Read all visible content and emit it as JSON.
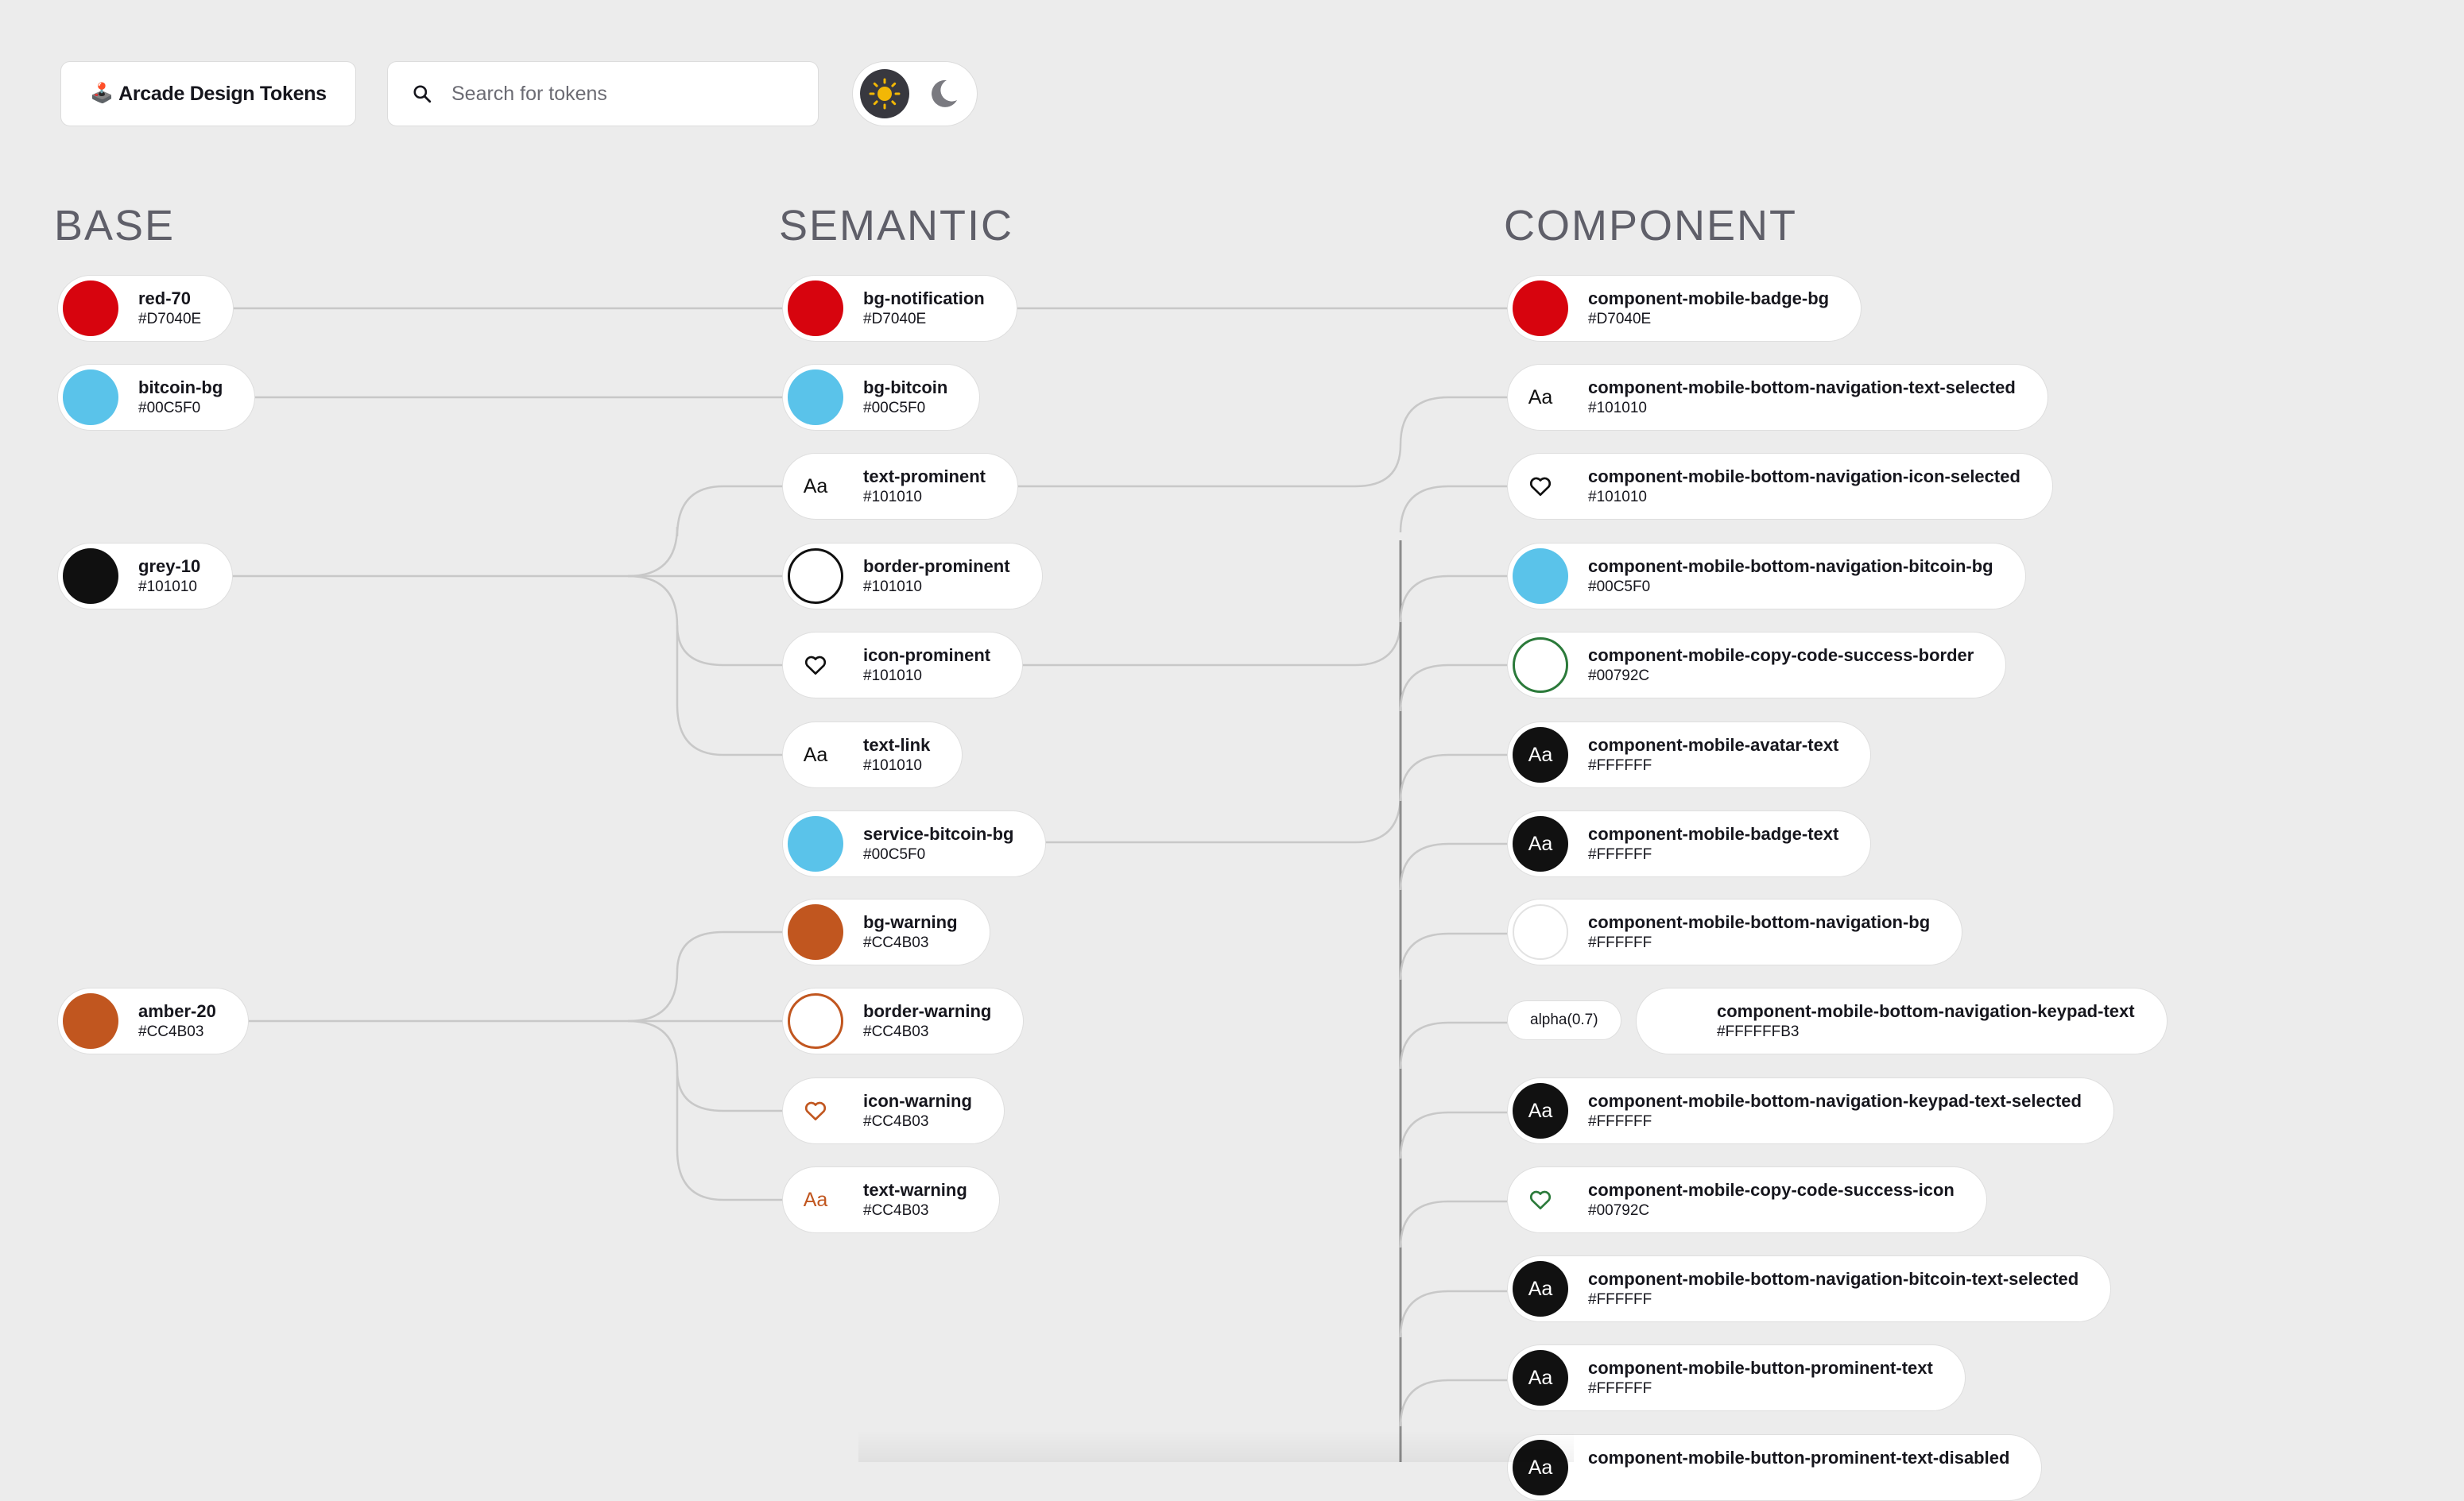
{
  "header": {
    "brand_emoji": "🕹️",
    "brand_title": "Arcade Design Tokens",
    "search_placeholder": "Search for tokens",
    "theme": {
      "light_icon": "sun-icon",
      "dark_icon": "moon-icon",
      "active": "light"
    }
  },
  "columns": {
    "base": "BASE",
    "semantic": "SEMANTIC",
    "component": "COMPONENT"
  },
  "colors": {
    "red": "#D7040E",
    "bitcoin": "#00C5F0",
    "grey": "#101010",
    "amber": "#CC4B03",
    "white": "#FFFFFF",
    "green": "#00792C"
  },
  "base": [
    {
      "name": "red-70",
      "hex": "#D7040E",
      "kind": "fill"
    },
    {
      "name": "bitcoin-bg",
      "hex": "#00C5F0",
      "kind": "fill"
    },
    {
      "name": "grey-10",
      "hex": "#101010",
      "kind": "fill"
    },
    {
      "name": "amber-20",
      "hex": "#CC4B03",
      "kind": "fill"
    }
  ],
  "semantic": [
    {
      "name": "bg-notification",
      "hex": "#D7040E",
      "kind": "fill"
    },
    {
      "name": "bg-bitcoin",
      "hex": "#00C5F0",
      "kind": "fill"
    },
    {
      "name": "text-prominent",
      "hex": "#101010",
      "kind": "text",
      "glyph": "Aa"
    },
    {
      "name": "border-prominent",
      "hex": "#101010",
      "kind": "ring"
    },
    {
      "name": "icon-prominent",
      "hex": "#101010",
      "kind": "icon"
    },
    {
      "name": "text-link",
      "hex": "#101010",
      "kind": "text",
      "glyph": "Aa"
    },
    {
      "name": "service-bitcoin-bg",
      "hex": "#00C5F0",
      "kind": "fill"
    },
    {
      "name": "bg-warning",
      "hex": "#CC4B03",
      "kind": "fill"
    },
    {
      "name": "border-warning",
      "hex": "#CC4B03",
      "kind": "ring"
    },
    {
      "name": "icon-warning",
      "hex": "#CC4B03",
      "kind": "icon"
    },
    {
      "name": "text-warning",
      "hex": "#CC4B03",
      "kind": "text",
      "glyph": "Aa"
    }
  ],
  "component": [
    {
      "name": "component-mobile-badge-bg",
      "hex": "#D7040E",
      "kind": "fill"
    },
    {
      "name": "component-mobile-bottom-navigation-text-selected",
      "hex": "#101010",
      "kind": "text",
      "glyph": "Aa"
    },
    {
      "name": "component-mobile-bottom-navigation-icon-selected",
      "hex": "#101010",
      "kind": "icon"
    },
    {
      "name": "component-mobile-bottom-navigation-bitcoin-bg",
      "hex": "#00C5F0",
      "kind": "fill"
    },
    {
      "name": "component-mobile-copy-code-success-border",
      "hex": "#00792C",
      "kind": "ring"
    },
    {
      "name": "component-mobile-avatar-text",
      "hex": "#FFFFFF",
      "kind": "text-dark",
      "glyph": "Aa"
    },
    {
      "name": "component-mobile-badge-text",
      "hex": "#FFFFFF",
      "kind": "text-dark",
      "glyph": "Aa"
    },
    {
      "name": "component-mobile-bottom-navigation-bg",
      "hex": "#FFFFFF",
      "kind": "light"
    },
    {
      "name": "component-mobile-bottom-navigation-keypad-text",
      "hex": "#FFFFFFB3",
      "kind": "none",
      "alpha": "alpha(0.7)"
    },
    {
      "name": "component-mobile-bottom-navigation-keypad-text-selected",
      "hex": "#FFFFFF",
      "kind": "text-dark",
      "glyph": "Aa"
    },
    {
      "name": "component-mobile-copy-code-success-icon",
      "hex": "#00792C",
      "kind": "icon"
    },
    {
      "name": "component-mobile-bottom-navigation-bitcoin-text-selected",
      "hex": "#FFFFFF",
      "kind": "text-dark",
      "glyph": "Aa"
    },
    {
      "name": "component-mobile-button-prominent-text",
      "hex": "#FFFFFF",
      "kind": "text-dark",
      "glyph": "Aa"
    },
    {
      "name": "component-mobile-button-prominent-text-disabled",
      "hex": "",
      "kind": "text-dark",
      "glyph": "Aa"
    }
  ]
}
